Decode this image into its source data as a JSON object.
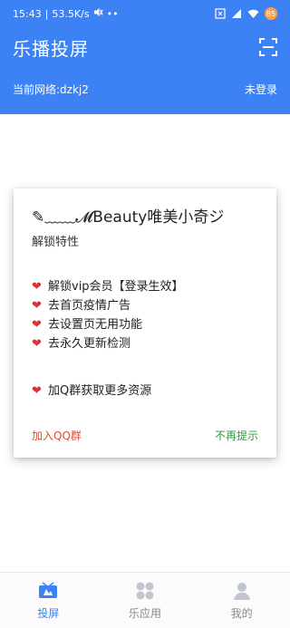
{
  "status": {
    "time": "15:43",
    "speed": "53.5K/s",
    "battery": "85",
    "battery_color": "#ff9f43"
  },
  "header": {
    "title": "乐播投屏",
    "network": "当前网络:dzkj2",
    "login": "未登录"
  },
  "dialog": {
    "title": "✎﹏﹏𝓜Beauty唯美小奇ジ",
    "subtitle": "解锁特性",
    "features": [
      "解锁vip会员【登录生效】",
      "去首页疫情广告",
      "去设置页无用功能",
      "去永久更新检测"
    ],
    "extra": "加Q群获取更多资源",
    "join_qq": "加入QQ群",
    "no_more": "不再提示"
  },
  "nav": {
    "items": [
      {
        "label": "投屏",
        "icon": "cast-icon",
        "active": true
      },
      {
        "label": "乐应用",
        "icon": "apps-grid-icon",
        "active": false
      },
      {
        "label": "我的",
        "icon": "profile-icon",
        "active": false
      }
    ]
  },
  "colors": {
    "primary": "#3d82f5",
    "heart": "#d9323c",
    "join": "#e14b2f",
    "dismiss": "#2b9a3b"
  }
}
